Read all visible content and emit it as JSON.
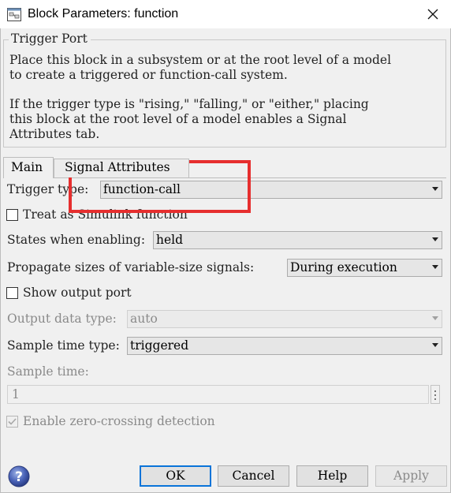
{
  "window": {
    "title": "Block Parameters: function"
  },
  "group": {
    "legend": "Trigger Port",
    "description_1": "Place this block in a subsystem or at the root level of a model\nto create a triggered or function-call system.",
    "description_2": "If the trigger type is \"rising,\" \"falling,\" or \"either,\" placing\nthis block at the root level of a model enables a Signal\nAttributes tab."
  },
  "tabs": [
    {
      "label": "Main",
      "selected": true
    },
    {
      "label": "Signal Attributes",
      "selected": false
    }
  ],
  "params": {
    "trigger_type": {
      "label": "Trigger type:",
      "value": "function-call"
    },
    "treat_as_simulink_function": {
      "label": "Treat as Simulink function",
      "checked": false
    },
    "states_when_enabling": {
      "label": "States when enabling:",
      "value": "held"
    },
    "propagate_sizes": {
      "label": "Propagate sizes of variable-size signals:",
      "value": "During execution"
    },
    "show_output_port": {
      "label": "Show output port",
      "checked": false
    },
    "output_data_type": {
      "label": "Output data type:",
      "value": "auto",
      "enabled": false
    },
    "sample_time_type": {
      "label": "Sample time type:",
      "value": "triggered"
    },
    "sample_time": {
      "label": "Sample time:",
      "value": "1",
      "enabled": false
    },
    "enable_zero_crossing": {
      "label": "Enable zero-crossing detection",
      "checked": true,
      "enabled": false
    }
  },
  "buttons": {
    "ok": "OK",
    "cancel": "Cancel",
    "help": "Help",
    "apply": "Apply"
  },
  "highlight": {
    "color": "#e62e2e"
  },
  "icons": {
    "app": "simulink-block-icon",
    "close": "close-icon",
    "help": "help-icon",
    "dropdown": "chevron-down-icon",
    "more": "vertical-ellipsis-icon",
    "check": "checkmark-icon"
  }
}
